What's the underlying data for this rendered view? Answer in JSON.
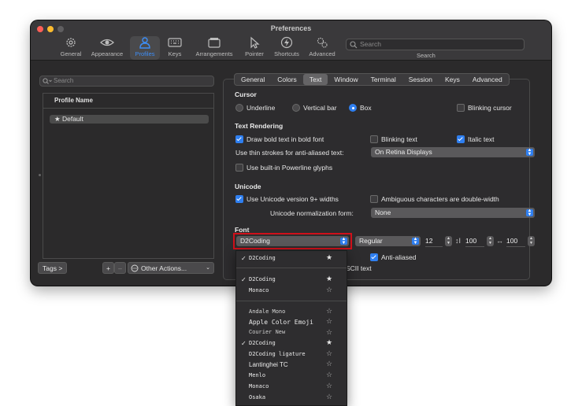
{
  "window": {
    "title": "Preferences"
  },
  "toolbar": {
    "items": [
      {
        "label": "General",
        "icon": "gear-icon"
      },
      {
        "label": "Appearance",
        "icon": "eye-icon"
      },
      {
        "label": "Profiles",
        "icon": "person-icon"
      },
      {
        "label": "Keys",
        "icon": "keyboard-icon"
      },
      {
        "label": "Arrangements",
        "icon": "windows-icon"
      },
      {
        "label": "Pointer",
        "icon": "pointer-icon"
      },
      {
        "label": "Shortcuts",
        "icon": "bolt-icon"
      },
      {
        "label": "Advanced",
        "icon": "gears-icon"
      }
    ],
    "search_placeholder": "Search",
    "search_label": "Search"
  },
  "sidebar": {
    "search_placeholder": "Search",
    "list_header": "Profile Name",
    "profiles": [
      "★ Default"
    ],
    "tags_button": "Tags >",
    "add_button": "+",
    "remove_button": "–",
    "other_actions": "Other Actions..."
  },
  "tabs": [
    "General",
    "Colors",
    "Text",
    "Window",
    "Terminal",
    "Session",
    "Keys",
    "Advanced"
  ],
  "active_tab": "Text",
  "cursor": {
    "heading": "Cursor",
    "options": [
      "Underline",
      "Vertical bar",
      "Box"
    ],
    "selected": "Box",
    "blinking_label": "Blinking cursor",
    "blinking": false
  },
  "text_rendering": {
    "heading": "Text Rendering",
    "bold_label": "Draw bold text in bold font",
    "bold": true,
    "blinking_text_label": "Blinking text",
    "blinking_text": false,
    "italic_label": "Italic text",
    "italic": true,
    "thin_strokes_label": "Use thin strokes for anti-aliased text:",
    "thin_strokes_value": "On Retina Displays",
    "powerline_label": "Use built-in Powerline glyphs",
    "powerline": false
  },
  "unicode": {
    "heading": "Unicode",
    "v9_label": "Use Unicode version 9+ widths",
    "v9": true,
    "ambiguous_label": "Ambiguous characters are double-width",
    "ambiguous": false,
    "normalization_label": "Unicode normalization form:",
    "normalization_value": "None"
  },
  "font": {
    "heading": "Font",
    "family": "D2Coding",
    "style": "Regular",
    "size": "12",
    "v_spacing": "100",
    "h_spacing": "100",
    "anti_aliased_label": "Anti-aliased",
    "anti_aliased": true,
    "partial_label": "SCII text"
  },
  "font_menu": {
    "current": {
      "name": "D2Coding",
      "checked": true,
      "favorite": true
    },
    "favorites": [
      {
        "name": "D2Coding",
        "checked": true,
        "favorite": true
      },
      {
        "name": "Monaco",
        "checked": false,
        "favorite": false
      }
    ],
    "all": [
      {
        "name": "Andale Mono",
        "checked": false,
        "favorite": false
      },
      {
        "name": "Apple  Color  Emoji",
        "checked": false,
        "favorite": false
      },
      {
        "name": "Courier New",
        "checked": false,
        "favorite": false
      },
      {
        "name": "D2Coding",
        "checked": true,
        "favorite": true
      },
      {
        "name": "D2Coding ligature",
        "checked": false,
        "favorite": false
      },
      {
        "name": "Lantinghei TC",
        "checked": false,
        "favorite": false
      },
      {
        "name": "Menlo",
        "checked": false,
        "favorite": false
      },
      {
        "name": "Monaco",
        "checked": false,
        "favorite": false
      },
      {
        "name": "Osaka",
        "checked": false,
        "favorite": false
      }
    ]
  },
  "colors": {
    "accent": "#2f7ff0",
    "highlight_border": "#d0101a",
    "window_bg": "#2b2a2b"
  }
}
